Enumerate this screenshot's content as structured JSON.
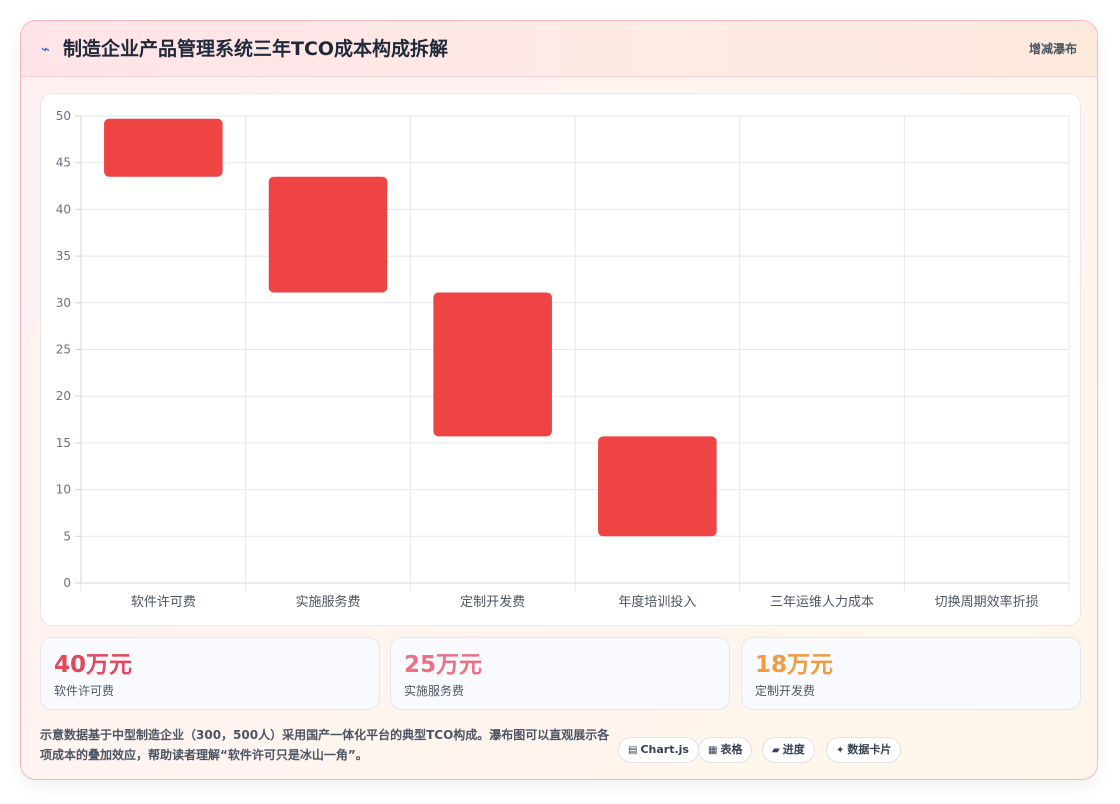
{
  "header": {
    "title": "制造企业产品管理系统三年TCO成本构成拆解",
    "tag": "增减瀑布"
  },
  "chart_data": {
    "type": "bar",
    "subtype": "waterfall",
    "categories": [
      "软件许可费",
      "实施服务费",
      "定制开发费",
      "年度培训投入",
      "三年运维人力成本",
      "切换周期效率折损"
    ],
    "ranges": [
      [
        43.5,
        49.7
      ],
      [
        31.1,
        43.5
      ],
      [
        15.7,
        31.1
      ],
      [
        5.0,
        15.7
      ],
      null,
      null
    ],
    "ylim": [
      0,
      50
    ],
    "yticks": [
      0,
      5,
      10,
      15,
      20,
      25,
      30,
      35,
      40,
      45,
      50
    ],
    "grid": true,
    "bar_color": "#ef4444"
  },
  "stats": [
    {
      "value": "40万元",
      "label": "软件许可费",
      "color": "#e5485c"
    },
    {
      "value": "25万元",
      "label": "实施服务费",
      "color": "#ef6f86"
    },
    {
      "value": "18万元",
      "label": "定制开发费",
      "color": "#f29a3e"
    }
  ],
  "footnote": "示意数据基于中型制造企业（300，500人）采用国产一体化平台的典型TCO构成。瀑布图可以直观展示各项成本的叠加效应，帮助读者理解“软件许可只是冰山一角”。",
  "chips": [
    {
      "icon": "chart-icon",
      "label": "Chart.js"
    },
    {
      "icon": "table-icon",
      "label": "表格"
    },
    {
      "icon": "progress-icon",
      "label": "进度"
    },
    {
      "icon": "sparkle-icon",
      "label": "数据卡片"
    }
  ]
}
